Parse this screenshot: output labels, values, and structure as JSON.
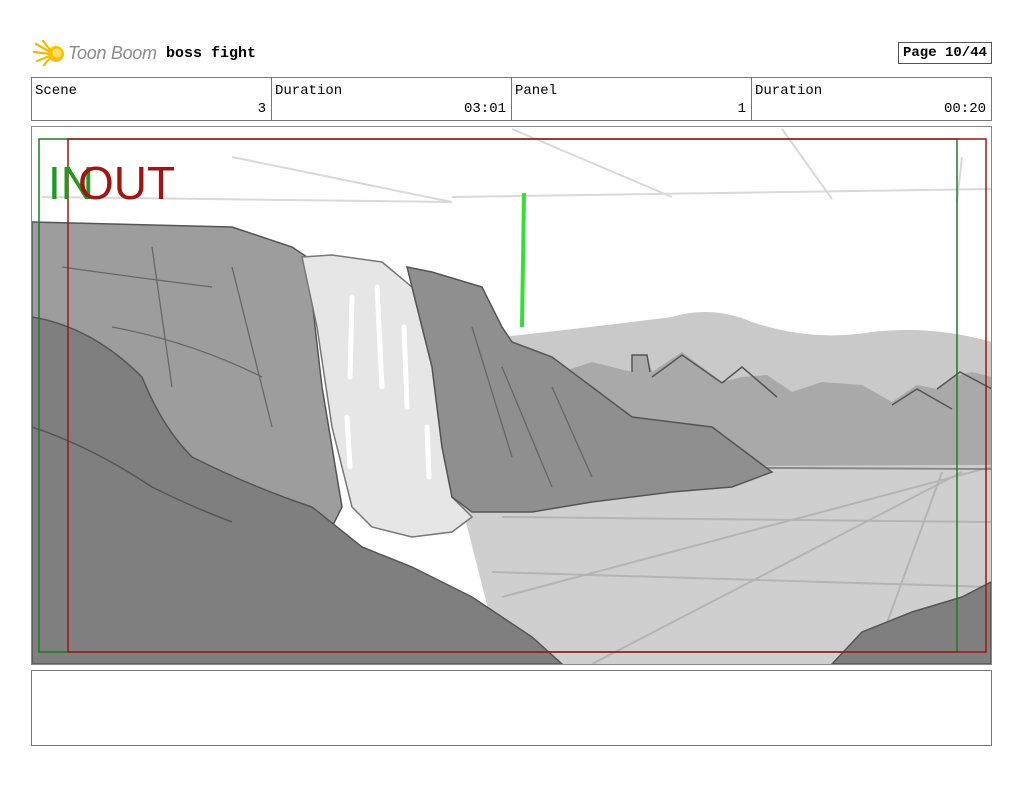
{
  "header": {
    "logo_text": "Toon Boom",
    "project_title": "boss fight",
    "page": "Page 10/44"
  },
  "info": {
    "scene_label": "Scene",
    "scene_value": "3",
    "scene_duration_label": "Duration",
    "scene_duration_value": "03:01",
    "panel_label": "Panel",
    "panel_value": "1",
    "panel_duration_label": "Duration",
    "panel_duration_value": "00:20"
  },
  "panel": {
    "in_label": "IN",
    "out_label": "OUT",
    "in_color": "#1f9a1f",
    "out_color": "#a01414"
  },
  "notes": {
    "text": ""
  }
}
